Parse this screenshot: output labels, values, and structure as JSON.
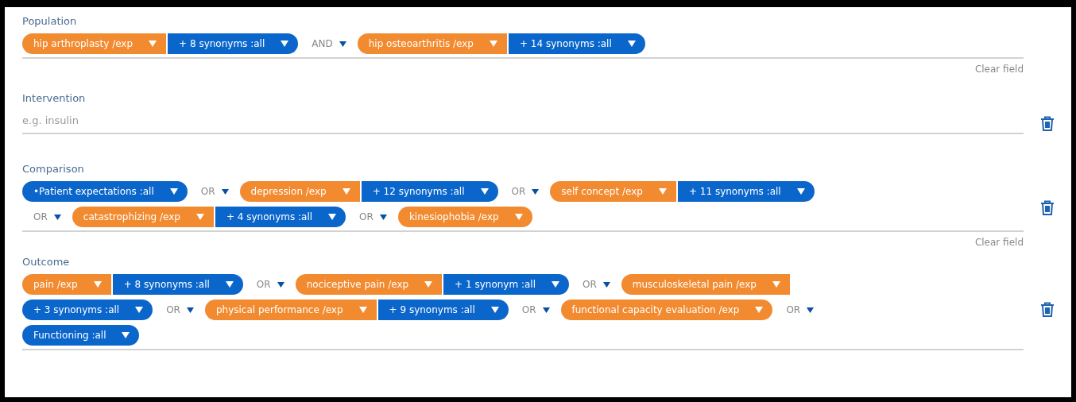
{
  "fields": [
    {
      "label": "Population",
      "kind": "tokens",
      "deletable": false,
      "clear": "Clear field",
      "lines": [
        [
          {
            "kind": "term",
            "text": "hip arthroplasty /exp"
          },
          {
            "kind": "synonyms",
            "text": "+ 8 synonyms :all"
          },
          {
            "kind": "operator",
            "text": "AND"
          },
          {
            "kind": "term",
            "text": "hip osteoarthritis /exp"
          },
          {
            "kind": "synonyms",
            "text": "+ 14 synonyms :all"
          }
        ]
      ]
    },
    {
      "label": "Intervention",
      "kind": "text",
      "deletable": true,
      "placeholder": "e.g. insulin"
    },
    {
      "label": "Comparison",
      "kind": "tokens",
      "deletable": true,
      "clear": "Clear field",
      "lines": [
        [
          {
            "kind": "concept",
            "text": "•Patient expectations :all"
          },
          {
            "kind": "operator",
            "text": "OR"
          },
          {
            "kind": "term",
            "text": "depression /exp"
          },
          {
            "kind": "synonyms",
            "text": "+ 12 synonyms :all"
          },
          {
            "kind": "operator",
            "text": "OR"
          },
          {
            "kind": "term",
            "text": "self concept /exp"
          },
          {
            "kind": "synonyms",
            "text": "+ 11 synonyms :all"
          }
        ],
        [
          {
            "kind": "operator",
            "text": "OR"
          },
          {
            "kind": "term",
            "text": "catastrophizing /exp"
          },
          {
            "kind": "synonyms",
            "text": "+ 4 synonyms :all"
          },
          {
            "kind": "operator",
            "text": "OR"
          },
          {
            "kind": "term",
            "text": "kinesiophobia /exp"
          }
        ]
      ]
    },
    {
      "label": "Outcome",
      "kind": "tokens",
      "deletable": true,
      "lines": [
        [
          {
            "kind": "term",
            "text": "pain /exp"
          },
          {
            "kind": "synonyms",
            "text": "+ 8 synonyms :all"
          },
          {
            "kind": "operator",
            "text": "OR"
          },
          {
            "kind": "term",
            "text": "nociceptive pain /exp"
          },
          {
            "kind": "synonyms",
            "text": "+ 1 synonym :all"
          },
          {
            "kind": "operator",
            "text": "OR"
          },
          {
            "kind": "term",
            "text": "musculoskeletal pain /exp"
          }
        ],
        [
          {
            "kind": "synonyms",
            "text": "+ 3 synonyms :all"
          },
          {
            "kind": "operator",
            "text": "OR"
          },
          {
            "kind": "term",
            "text": "physical performance /exp"
          },
          {
            "kind": "synonyms",
            "text": "+ 9 synonyms :all"
          },
          {
            "kind": "operator",
            "text": "OR"
          },
          {
            "kind": "term",
            "text": "functional capacity evaluation /exp"
          },
          {
            "kind": "operator",
            "text": "OR"
          }
        ],
        [
          {
            "kind": "concept",
            "text": "Functioning :all"
          }
        ]
      ]
    }
  ]
}
